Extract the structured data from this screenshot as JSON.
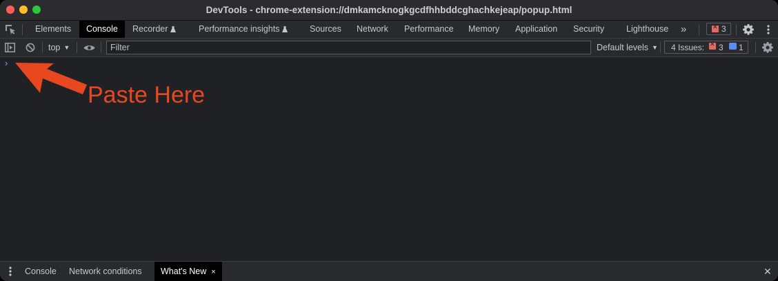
{
  "window": {
    "title": "DevTools - chrome-extension://dmkamcknogkgcdfhhbddcghachkejeap/popup.html"
  },
  "tabs": [
    {
      "label": "Elements"
    },
    {
      "label": "Console",
      "active": true
    },
    {
      "label": "Recorder",
      "experimental": true
    },
    {
      "label": "Performance insights",
      "experimental": true
    },
    {
      "label": "Sources"
    },
    {
      "label": "Network"
    },
    {
      "label": "Performance"
    },
    {
      "label": "Memory"
    },
    {
      "label": "Application"
    },
    {
      "label": "Security"
    },
    {
      "label": "Lighthouse"
    }
  ],
  "tabbar": {
    "more_tabs_glyph": "»",
    "error_count": "3"
  },
  "console_toolbar": {
    "context": "top",
    "filter_placeholder": "Filter",
    "levels": "Default levels",
    "issues_label": "4 Issues:",
    "issues_errors": "3",
    "issues_info": "1"
  },
  "console": {
    "prompt": "›"
  },
  "annotation": {
    "text": "Paste Here",
    "color": "#e8481f"
  },
  "drawer": {
    "tabs": [
      {
        "label": "Console"
      },
      {
        "label": "Network conditions"
      },
      {
        "label": "What's New",
        "active": true
      }
    ],
    "close_tab_glyph": "×",
    "close_glyph": "✕"
  },
  "colors": {
    "background": "#202124",
    "toolbar": "#292a2d",
    "active_tab": "#000000",
    "error": "#e46962",
    "info": "#5b8def"
  },
  "icons": [
    "inspect-element-icon",
    "flask-icon",
    "error-icon",
    "gear-icon",
    "more-vert-icon",
    "sidebar-toggle-icon",
    "clear-console-icon",
    "eye-icon",
    "info-message-icon",
    "arrow-annotation",
    "drawer-menu-icon",
    "close-icon"
  ]
}
